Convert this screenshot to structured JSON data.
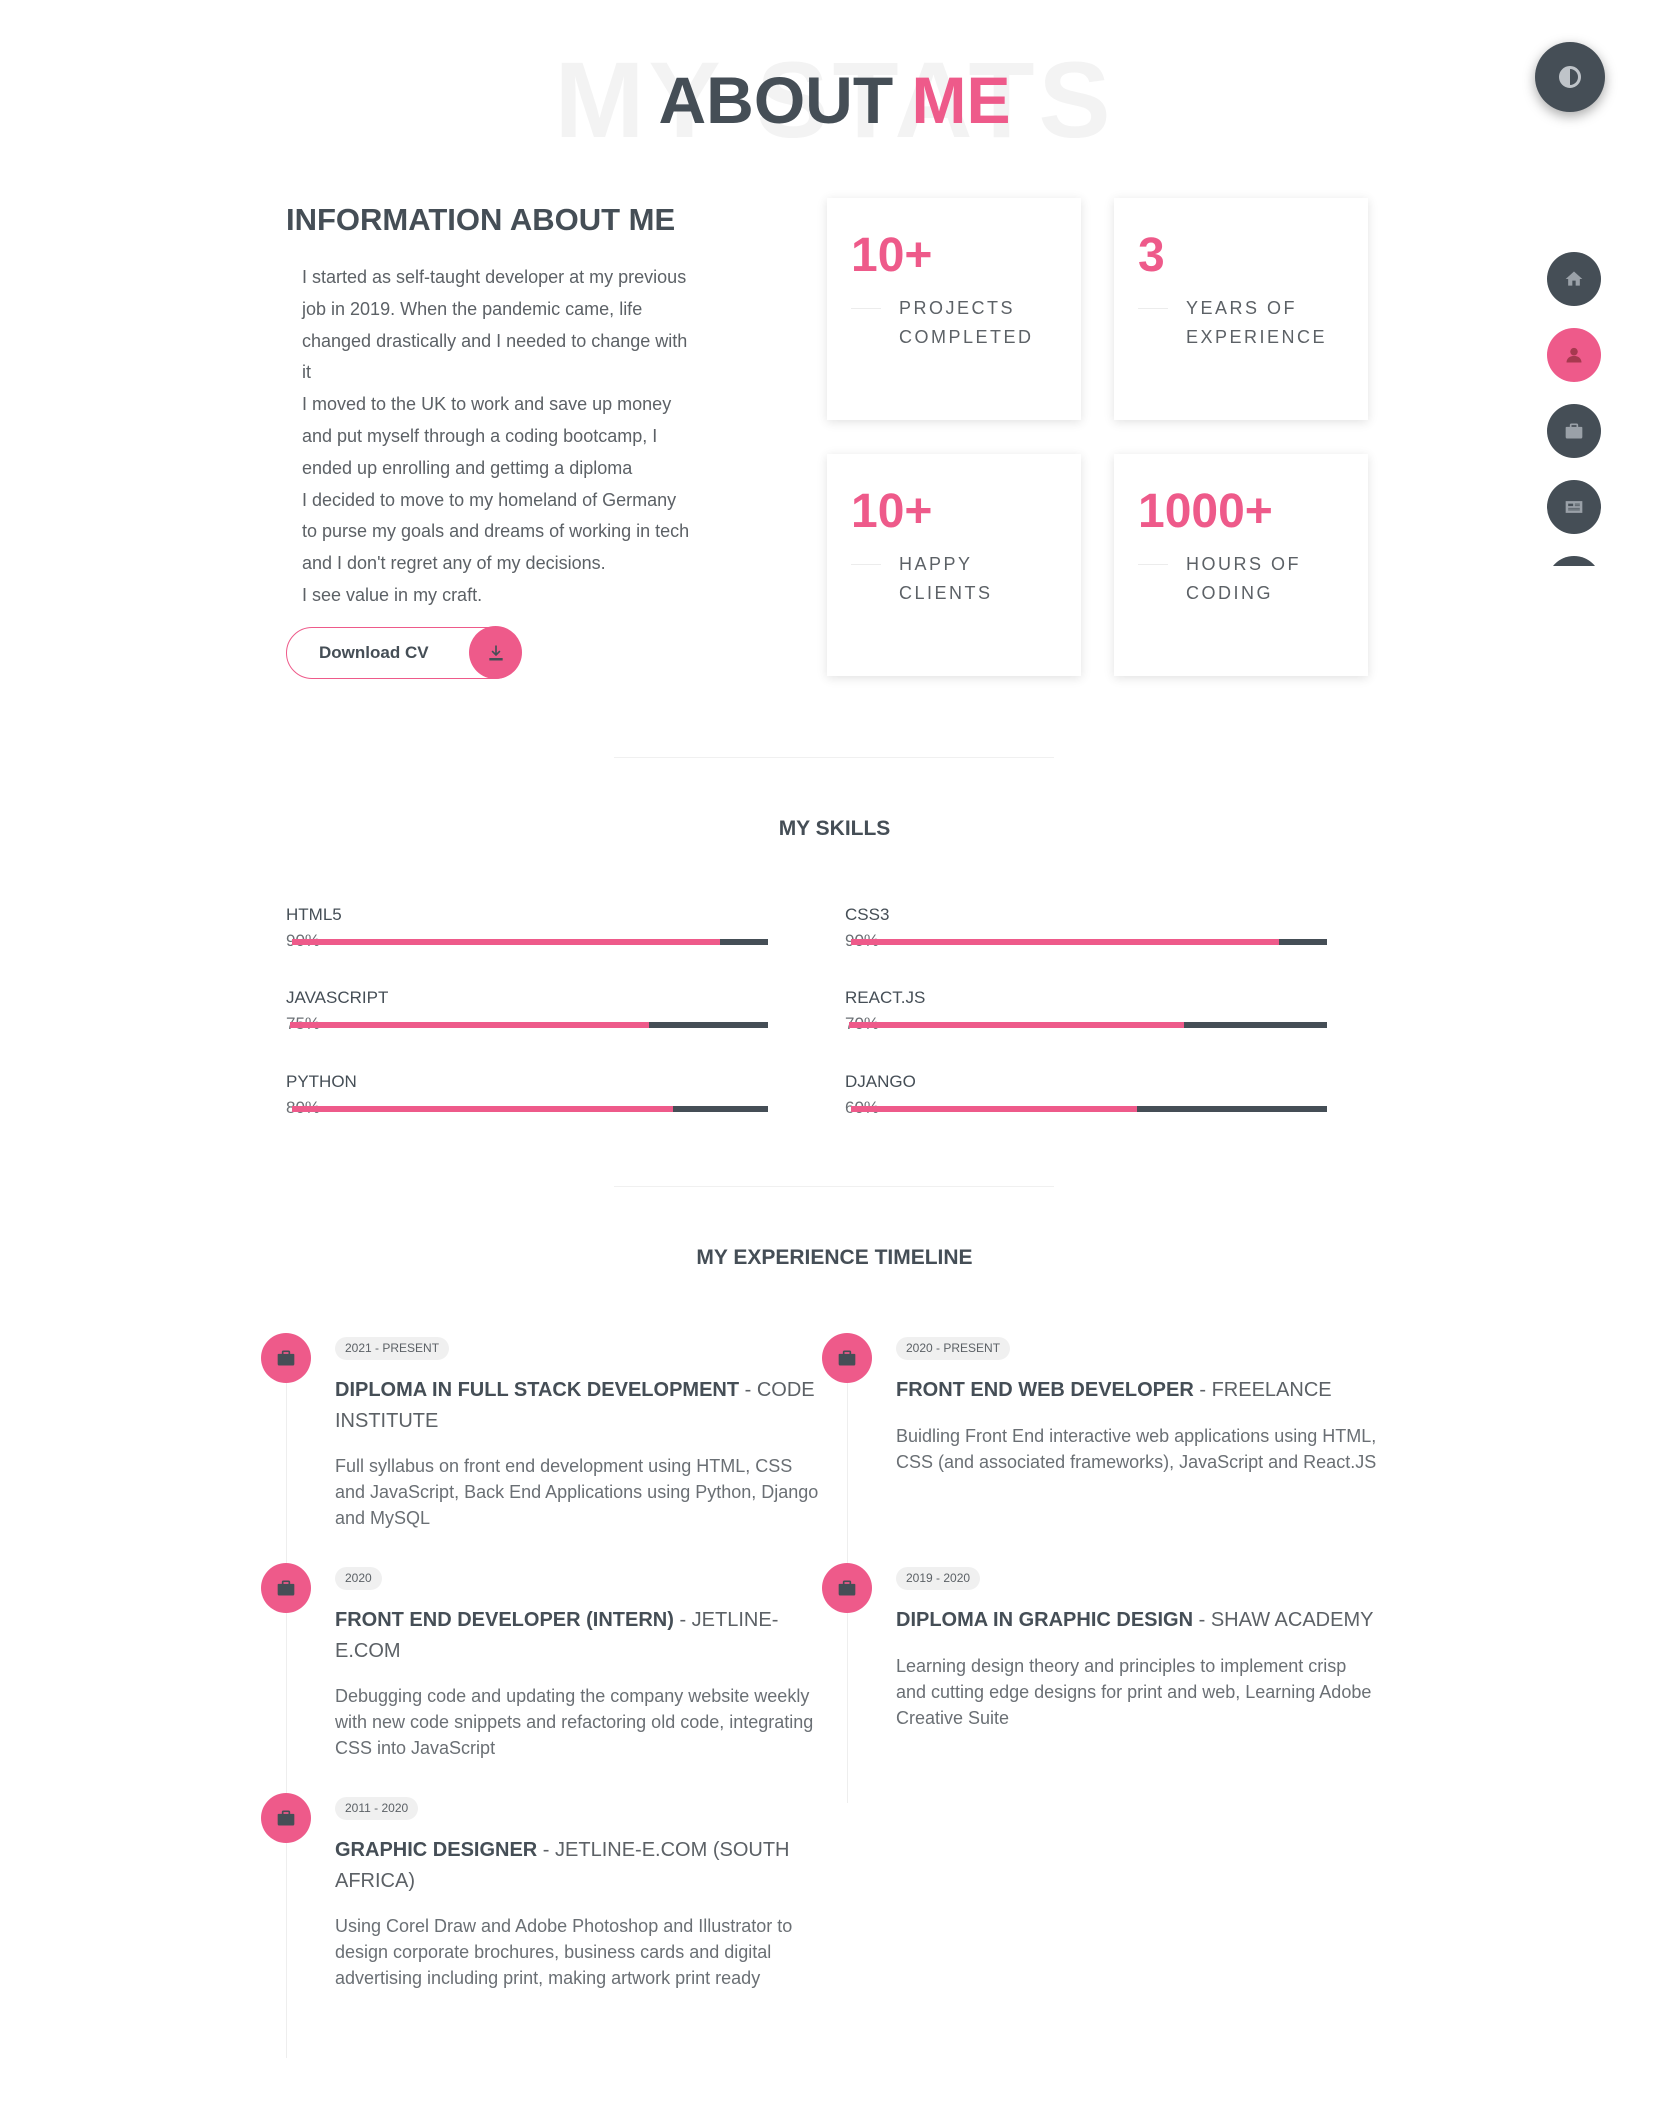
{
  "hero": {
    "title": "ABOUT",
    "title_accent": "ME",
    "background_text": "MY STATS"
  },
  "controls": {
    "theme_icon": "half-circle-icon",
    "nav_items": [
      {
        "icon": "home-icon",
        "active": false
      },
      {
        "icon": "user-icon",
        "active": true
      },
      {
        "icon": "briefcase-icon",
        "active": false
      },
      {
        "icon": "newspaper-icon",
        "active": false
      }
    ]
  },
  "info": {
    "heading": "INFORMATION ABOUT ME",
    "lines": [
      "I started as self-taught developer at my previous",
      "job in 2019. When the pandemic came, life",
      "changed drastically and I needed to change with",
      "it",
      "I moved to the UK to work and save up money",
      "and put myself through a coding bootcamp, I",
      "ended up enrolling and gettimg a diploma",
      "I decided to move to my homeland of Germany",
      "to purse my goals and dreams of working in tech",
      "and I don't regret any of my decisions.",
      "I see value in my craft."
    ],
    "download_label": "Download CV",
    "download_icon": "download-icon"
  },
  "stats": [
    {
      "value": "10+",
      "label_1": "PROJECTS",
      "label_2": "COMPLETED"
    },
    {
      "value": "3",
      "label_1": "YEARS OF",
      "label_2": "EXPERIENCE"
    },
    {
      "value": "10+",
      "label_1": "HAPPY",
      "label_2": "CLIENTS"
    },
    {
      "value": "1000+",
      "label_1": "HOURS OF",
      "label_2": "CODING"
    }
  ],
  "skills": {
    "title": "MY SKILLS",
    "items": [
      {
        "name": "HTML5",
        "percent_label": "90%",
        "level": 0.9
      },
      {
        "name": "CSS3",
        "percent_label": "90%",
        "level": 0.9
      },
      {
        "name": "JAVASCRIPT",
        "percent_label": "75%",
        "level": 0.75
      },
      {
        "name": "REACT.JS",
        "percent_label": "70%",
        "level": 0.7
      },
      {
        "name": "PYTHON",
        "percent_label": "80%",
        "level": 0.8
      },
      {
        "name": "DJANGO",
        "percent_label": "60%",
        "level": 0.6
      }
    ]
  },
  "timeline": {
    "title": "MY EXPERIENCE TIMELINE",
    "items": [
      {
        "date": "2021 - PRESENT",
        "role": "DIPLOMA IN FULL STACK DEVELOPMENT",
        "org": " - CODE INSTITUTE",
        "desc": "Full syllabus on front end development using HTML, CSS and JavaScript, Back End Applications using Python, Django and MySQL",
        "icon": "briefcase-icon"
      },
      {
        "date": "2020 - PRESENT",
        "role": "FRONT END WEB DEVELOPER",
        "org": " - FREELANCE",
        "desc": "Buidling Front End interactive web applications using HTML, CSS (and associated frameworks), JavaScript and React.JS",
        "icon": "briefcase-icon"
      },
      {
        "date": "2020",
        "role": "FRONT END DEVELOPER (INTERN)",
        "org": " - JETLINE-E.COM",
        "desc": "Debugging code and updating the company website weekly with new code snippets and refactoring old code, integrating CSS into JavaScript",
        "icon": "briefcase-icon"
      },
      {
        "date": "2019 - 2020",
        "role": "DIPLOMA IN GRAPHIC DESIGN",
        "org": " - SHAW ACADEMY",
        "desc": "Learning design theory and principles to implement crisp and cutting edge designs for print and web, Learning Adobe Creative Suite",
        "icon": "briefcase-icon"
      },
      {
        "date": "2011 - 2020",
        "role": "GRAPHIC DESIGNER",
        "org": " - JETLINE-E.COM (SOUTH AFRICA)",
        "desc": "Using Corel Draw and Adobe Photoshop and Illustrator to design corporate brochures, business cards and digital advertising including print, making artwork print ready",
        "icon": "briefcase-icon"
      }
    ]
  },
  "colors": {
    "accent": "#ee5a8a",
    "dark": "#454e56"
  }
}
